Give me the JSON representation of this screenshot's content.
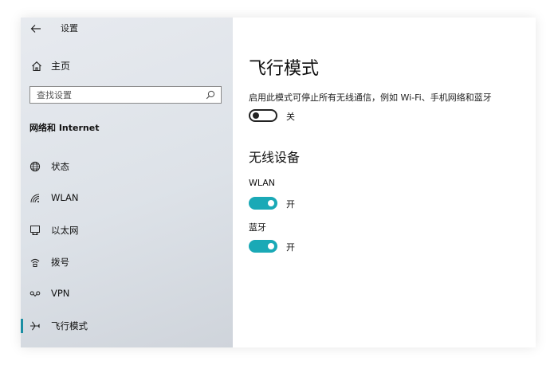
{
  "window": {
    "back_icon": "back-arrow-icon",
    "app_title": "设置"
  },
  "sidebar": {
    "home": {
      "icon": "home-icon",
      "label": "主页"
    },
    "search": {
      "placeholder": "查找设置",
      "value": "",
      "icon": "search-icon"
    },
    "section_title": "网络和 Internet",
    "items": [
      {
        "id": "status",
        "label": "状态",
        "icon": "globe-icon",
        "active": false
      },
      {
        "id": "wlan",
        "label": "WLAN",
        "icon": "wifi-icon",
        "active": false
      },
      {
        "id": "ethernet",
        "label": "以太网",
        "icon": "ethernet-icon",
        "active": false
      },
      {
        "id": "dialup",
        "label": "拨号",
        "icon": "dialup-icon",
        "active": false
      },
      {
        "id": "vpn",
        "label": "VPN",
        "icon": "vpn-icon",
        "active": false
      },
      {
        "id": "airplane",
        "label": "飞行模式",
        "icon": "airplane-icon",
        "active": true
      }
    ]
  },
  "main": {
    "title": "飞行模式",
    "description": "启用此模式可停止所有无线通信，例如 Wi-Fi、手机网络和蓝牙",
    "airplane_toggle": {
      "state": "off",
      "state_label": "关"
    },
    "wireless_section_title": "无线设备",
    "devices": [
      {
        "label": "WLAN",
        "state": "on",
        "state_label": "开"
      },
      {
        "label": "蓝牙",
        "state": "on",
        "state_label": "开"
      }
    ]
  },
  "colors": {
    "accent": "#1aa9b6",
    "active_indicator": "#1b8ea3",
    "sidebar_bg": "#e3e7ec"
  }
}
